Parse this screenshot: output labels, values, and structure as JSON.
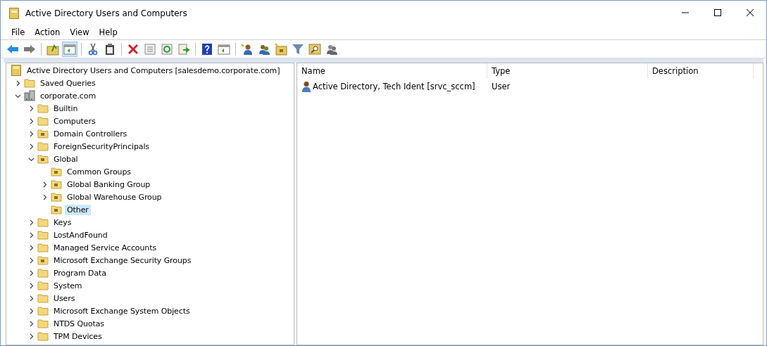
{
  "window": {
    "title": "Active Directory Users and Computers"
  },
  "menu": [
    "File",
    "Action",
    "View",
    "Help"
  ],
  "toolbar": [
    {
      "kind": "back",
      "pressed": false
    },
    {
      "kind": "forward",
      "pressed": false
    },
    {
      "kind": "sep"
    },
    {
      "kind": "up",
      "pressed": false
    },
    {
      "kind": "tree",
      "pressed": true
    },
    {
      "kind": "sep"
    },
    {
      "kind": "cut",
      "pressed": false
    },
    {
      "kind": "paste",
      "pressed": false
    },
    {
      "kind": "sep"
    },
    {
      "kind": "delete",
      "pressed": false
    },
    {
      "kind": "properties",
      "pressed": false
    },
    {
      "kind": "refresh",
      "pressed": false
    },
    {
      "kind": "export",
      "pressed": false
    },
    {
      "kind": "sep"
    },
    {
      "kind": "help",
      "pressed": false
    },
    {
      "kind": "action",
      "pressed": false
    },
    {
      "kind": "sep"
    },
    {
      "kind": "user",
      "pressed": false
    },
    {
      "kind": "group",
      "pressed": false
    },
    {
      "kind": "ou",
      "pressed": false
    },
    {
      "kind": "filter",
      "pressed": false
    },
    {
      "kind": "find",
      "pressed": false
    },
    {
      "kind": "delegate",
      "pressed": false
    }
  ],
  "tree": {
    "label": "Active Directory Users and Computers [salesdemo.corporate.com]",
    "kind": "snapin",
    "selected": false,
    "children": [
      {
        "label": "Saved Queries",
        "kind": "folder",
        "selected": false,
        "expanded": false
      },
      {
        "label": "corporate.com",
        "kind": "domain",
        "selected": false,
        "expanded": true,
        "children": [
          {
            "label": "Builtin",
            "kind": "folder",
            "selected": false,
            "expanded": false
          },
          {
            "label": "Computers",
            "kind": "folder",
            "selected": false,
            "expanded": false
          },
          {
            "label": "Domain Controllers",
            "kind": "ou",
            "selected": false,
            "expanded": false
          },
          {
            "label": "ForeignSecurityPrincipals",
            "kind": "folder",
            "selected": false,
            "expanded": false
          },
          {
            "label": "Global",
            "kind": "ou",
            "selected": false,
            "expanded": true,
            "children": [
              {
                "label": "Common Groups",
                "kind": "ou",
                "selected": false
              },
              {
                "label": "Global Banking Group",
                "kind": "ou",
                "selected": false,
                "expanded": false
              },
              {
                "label": "Global Warehouse Group",
                "kind": "ou",
                "selected": false,
                "expanded": false
              },
              {
                "label": "Other",
                "kind": "ou",
                "selected": true
              }
            ]
          },
          {
            "label": "Keys",
            "kind": "folder",
            "selected": false,
            "expanded": false
          },
          {
            "label": "LostAndFound",
            "kind": "folder",
            "selected": false,
            "expanded": false
          },
          {
            "label": "Managed Service Accounts",
            "kind": "folder",
            "selected": false,
            "expanded": false
          },
          {
            "label": "Microsoft Exchange Security Groups",
            "kind": "ou",
            "selected": false,
            "expanded": false
          },
          {
            "label": "Program Data",
            "kind": "folder",
            "selected": false,
            "expanded": false
          },
          {
            "label": "System",
            "kind": "folder",
            "selected": false,
            "expanded": false
          },
          {
            "label": "Users",
            "kind": "folder",
            "selected": false,
            "expanded": false
          },
          {
            "label": "Microsoft Exchange System Objects",
            "kind": "folder",
            "selected": false,
            "expanded": false
          },
          {
            "label": "NTDS Quotas",
            "kind": "folder",
            "selected": false,
            "expanded": false
          },
          {
            "label": "TPM Devices",
            "kind": "folder",
            "selected": false,
            "expanded": false
          }
        ]
      }
    ]
  },
  "list": {
    "columns": [
      "Name",
      "Type",
      "Description"
    ],
    "rows": [
      {
        "kind": "user",
        "name": "Active Directory, Tech Ident [srvc_sccm]",
        "type": "User"
      }
    ]
  }
}
